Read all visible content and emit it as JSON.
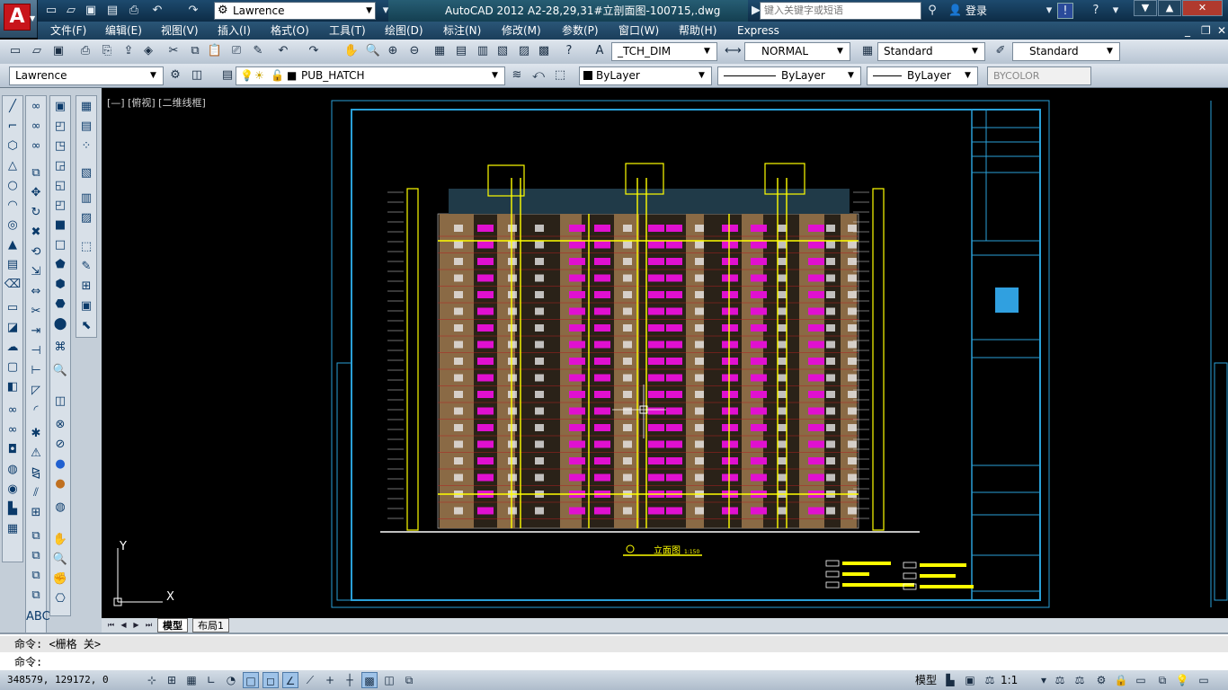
{
  "titlebar": {
    "app_title": "AutoCAD 2012    A2-28,29,31#立剖面图-100715,.dwg",
    "workspace": "Lawrence",
    "search_placeholder": "键入关键字或短语",
    "login": "登录"
  },
  "menu": [
    "文件(F)",
    "编辑(E)",
    "视图(V)",
    "插入(I)",
    "格式(O)",
    "工具(T)",
    "绘图(D)",
    "标注(N)",
    "修改(M)",
    "参数(P)",
    "窗口(W)",
    "帮助(H)",
    "Express"
  ],
  "toolbar1": {
    "dimstyle": "_TCH_DIM",
    "textstyle": "NORMAL",
    "tablestyle": "Standard",
    "mleaderstyle": "Standard"
  },
  "toolbar2": {
    "workspace": "Lawrence",
    "layer": "PUB_HATCH",
    "color": "ByLayer",
    "linetype": "ByLayer",
    "lineweight": "ByLayer",
    "plotstyle": "BYCOLOR"
  },
  "viewport_label": "[—] [俯视] [二维线框]",
  "drawing": {
    "elevation_title": "立面图",
    "elevation_scale": "1:150",
    "ucs_x": "X",
    "ucs_y": "Y"
  },
  "layout_tabs": [
    "模型",
    "布局1"
  ],
  "command": {
    "history": "命令:  <栅格 关>",
    "prompt": "命令:"
  },
  "status": {
    "coords": "348579, 129172, 0",
    "model_label": "模型",
    "scale": "1:1"
  },
  "colors": {
    "title_bg": "#1d4a6e",
    "menu_bg": "#2a5677",
    "accent_red": "#c8151b",
    "drawing_bg": "#000000",
    "facade_brown": "#8a6a45",
    "window_magenta": "#e010d0",
    "frame_cyan": "#2aa0d8",
    "line_yellow": "#ffff00"
  }
}
